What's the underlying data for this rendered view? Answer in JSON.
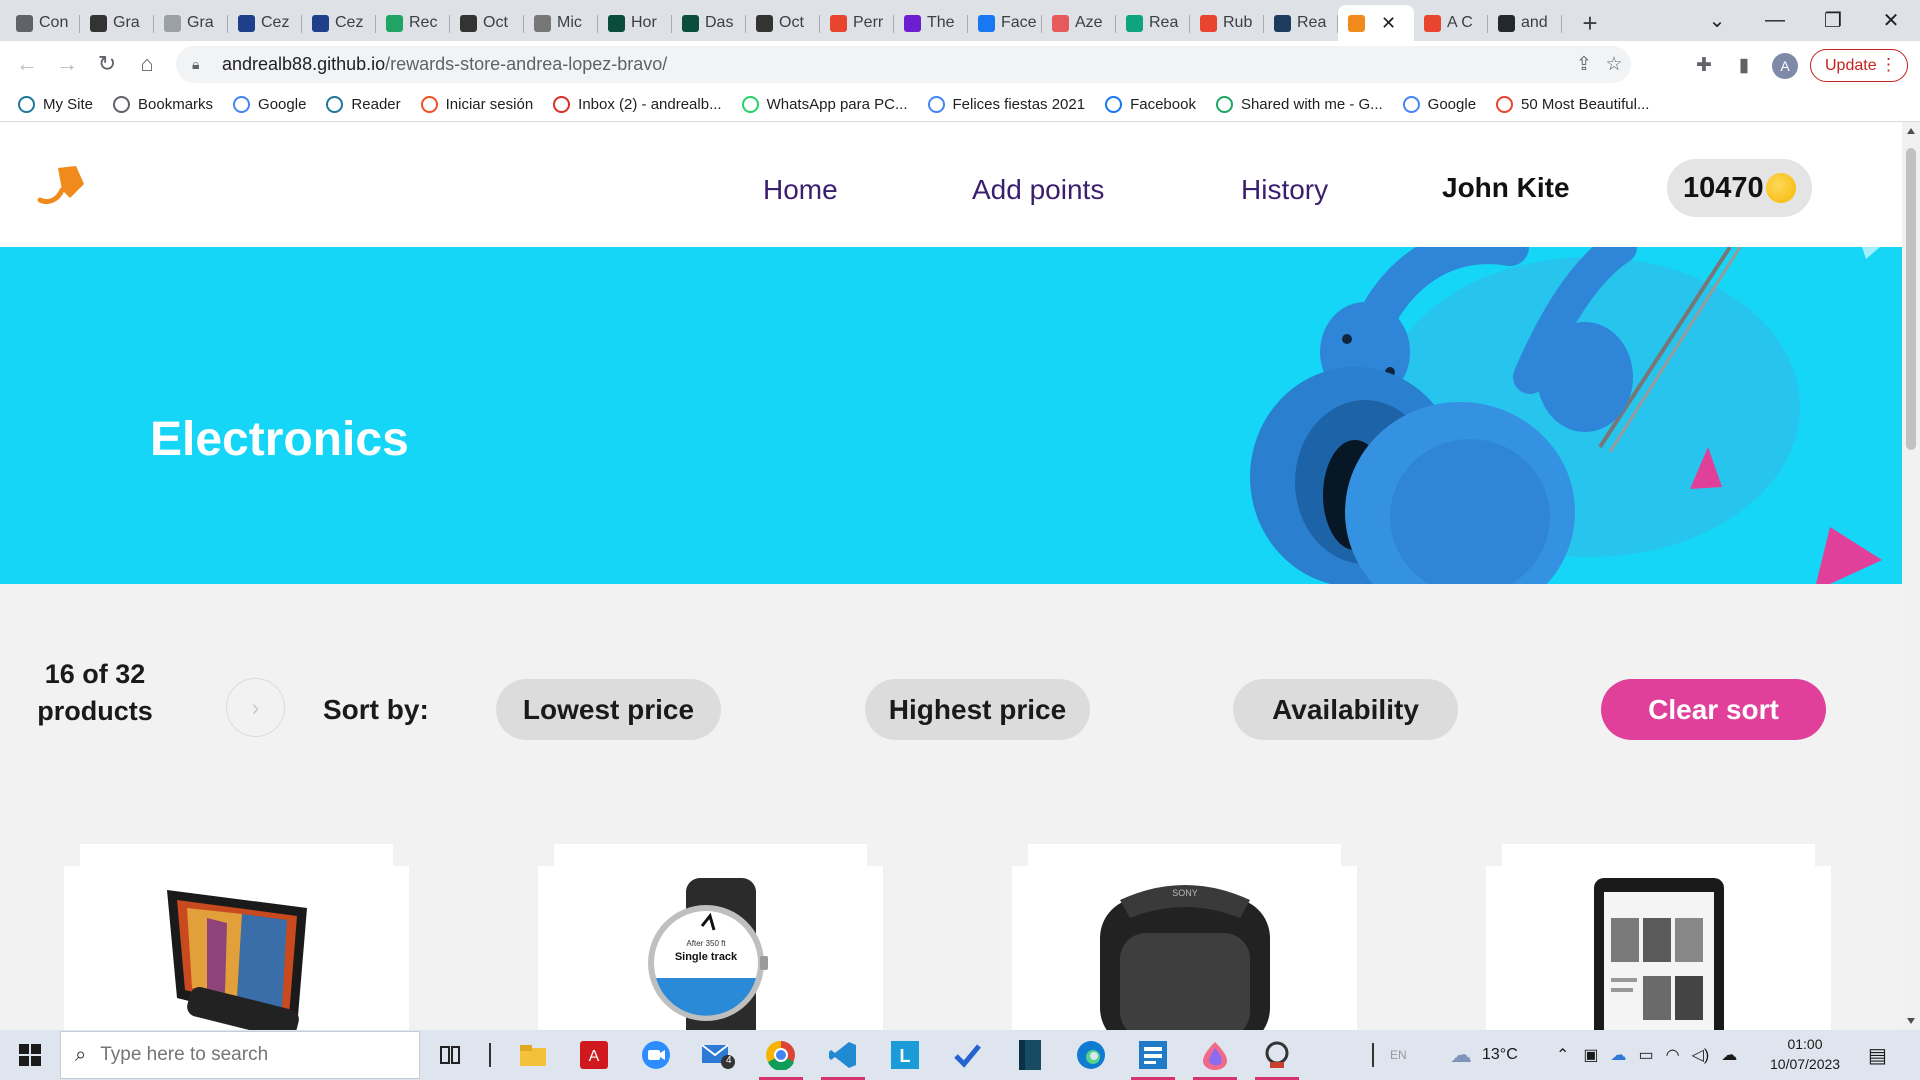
{
  "browser": {
    "tabs": [
      {
        "label": "Con",
        "icon": "chrome-icon",
        "color": "#5f6368"
      },
      {
        "label": "Gra",
        "icon": "b-icon",
        "color": "#333333"
      },
      {
        "label": "Gra",
        "icon": "cloud-icon",
        "color": "#9aa0a6"
      },
      {
        "label": "Cez",
        "icon": "cez-icon",
        "color": "#1e3f8a"
      },
      {
        "label": "Cez",
        "icon": "cez-icon",
        "color": "#1e3f8a"
      },
      {
        "label": "Rec",
        "icon": "drive-icon",
        "color": "#1fa463"
      },
      {
        "label": "Oct",
        "icon": "pen-icon",
        "color": "#333333"
      },
      {
        "label": "Mic",
        "icon": "globe-icon",
        "color": "#777777"
      },
      {
        "label": "Hor",
        "icon": "leaf-icon",
        "color": "#0a4d3c"
      },
      {
        "label": "Das",
        "icon": "leaf-icon",
        "color": "#0a4d3c"
      },
      {
        "label": "Oct",
        "icon": "pen-icon",
        "color": "#333333"
      },
      {
        "label": "Perr",
        "icon": "puzzle-icon",
        "color": "#e8442e"
      },
      {
        "label": "The",
        "icon": "arrow-icon",
        "color": "#6b1fd1"
      },
      {
        "label": "Face",
        "icon": "facebook-icon",
        "color": "#1877f2"
      },
      {
        "label": "Aze",
        "icon": "aup-icon",
        "color": "#e55a5a"
      },
      {
        "label": "Rea",
        "icon": "openai-icon",
        "color": "#10a37f"
      },
      {
        "label": "Rub",
        "icon": "puzzle-icon",
        "color": "#e8442e"
      },
      {
        "label": "Rea",
        "icon": "react-icon",
        "color": "#1d3b5c"
      },
      {
        "label": "",
        "icon": "rewards-icon",
        "color": "#f08a1c",
        "active": true
      },
      {
        "label": "A C",
        "icon": "asterisk-icon",
        "color": "#e8442e"
      },
      {
        "label": "and",
        "icon": "github-icon",
        "color": "#24292f"
      }
    ],
    "url_host": "andrealb88.github.io",
    "url_path": "/rewards-store-andrea-lopez-bravo/",
    "avatar_letter": "A",
    "update_label": "Update",
    "bookmarks": [
      {
        "label": "My Site",
        "icon": "wordpress-icon",
        "color": "#21759b"
      },
      {
        "label": "Bookmarks",
        "icon": "star-icon",
        "color": "#5f6368"
      },
      {
        "label": "Google",
        "icon": "google-icon",
        "color": "#4285f4"
      },
      {
        "label": "Reader",
        "icon": "wordpress-icon",
        "color": "#21759b"
      },
      {
        "label": "Iniciar sesión",
        "icon": "microsoft-icon",
        "color": "#f25022"
      },
      {
        "label": "Inbox (2) - andrealb...",
        "icon": "gmail-icon",
        "color": "#d93025"
      },
      {
        "label": "WhatsApp para PC...",
        "icon": "whatsapp-icon",
        "color": "#25d366"
      },
      {
        "label": "Felices fiestas 2021",
        "icon": "google-icon",
        "color": "#4285f4"
      },
      {
        "label": "Facebook",
        "icon": "facebook-icon",
        "color": "#1877f2"
      },
      {
        "label": "Shared with me - G...",
        "icon": "drive-icon",
        "color": "#1fa463"
      },
      {
        "label": "Google",
        "icon": "google-icon",
        "color": "#4285f4"
      },
      {
        "label": "50 Most Beautiful...",
        "icon": "dots-icon",
        "color": "#e8442e"
      }
    ]
  },
  "site": {
    "nav": {
      "home": "Home",
      "add_points": "Add points",
      "history": "History",
      "user": "John Kite",
      "points": "10470"
    },
    "hero_title": "Electronics",
    "count_label": "16 of 32 products",
    "sort_label": "Sort by:",
    "sort_options": {
      "lowest": "Lowest price",
      "highest": "Highest price",
      "availability": "Availability",
      "clear": "Clear sort"
    },
    "products": [
      {
        "icon": "tablet-icon"
      },
      {
        "icon": "smartwatch-icon",
        "screen_line1": "After 350 ft",
        "screen_line2": "Single track"
      },
      {
        "icon": "speaker-icon",
        "brand": "SONY"
      },
      {
        "icon": "ereader-icon"
      }
    ],
    "colors": {
      "hero_bg": "#15d6f6",
      "accent_pink": "#e0409a",
      "nav_purple": "#3b1f6e",
      "headphones_blue": "#2c8fe0"
    }
  },
  "taskbar": {
    "search_placeholder": "Type here to search",
    "mail_badge": "4",
    "weather": "13°C",
    "time": "01:00",
    "date": "10/07/2023"
  }
}
